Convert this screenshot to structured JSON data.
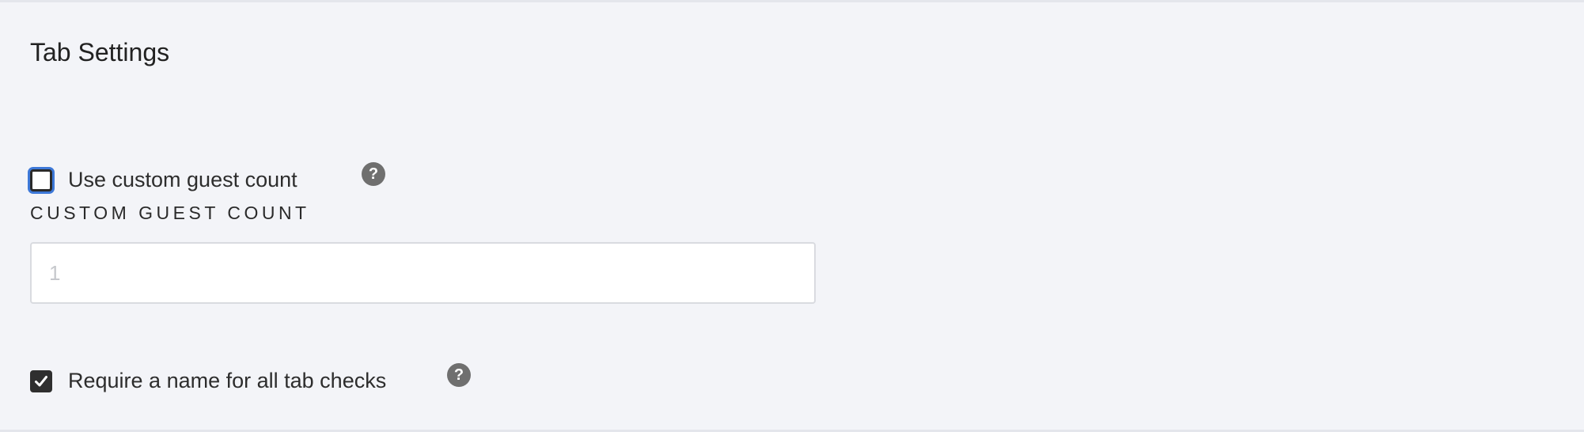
{
  "section": {
    "title": "Tab Settings"
  },
  "guest_count": {
    "checkbox_label": "Use custom guest count",
    "checked": false,
    "field_label": "Custom Guest Count",
    "input_value": "",
    "input_placeholder": "1",
    "help_icon": "question-mark-circle"
  },
  "require_name": {
    "checkbox_label": "Require a name for all tab checks",
    "checked": true,
    "help_icon": "question-mark-circle"
  },
  "colors": {
    "background": "#f3f4f8",
    "focus_ring": "#3d78d8",
    "checked_fill": "#2f2f2f",
    "help_icon": "#6f6f6f"
  }
}
